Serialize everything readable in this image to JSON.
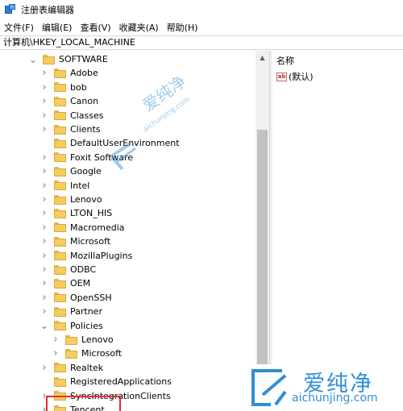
{
  "window": {
    "title": "注册表编辑器"
  },
  "menu": [
    {
      "label": "文件(F)"
    },
    {
      "label": "编辑(E)"
    },
    {
      "label": "查看(V)"
    },
    {
      "label": "收藏夹(A)"
    },
    {
      "label": "帮助(H)"
    }
  ],
  "address": {
    "path": "计算机\\HKEY_LOCAL_MACHINE"
  },
  "tree": {
    "items": [
      {
        "label": "SOFTWARE",
        "level": 0,
        "state": "expanded"
      },
      {
        "label": "Adobe",
        "level": 1,
        "state": "collapsed"
      },
      {
        "label": "bob",
        "level": 1,
        "state": "collapsed"
      },
      {
        "label": "Canon",
        "level": 1,
        "state": "collapsed"
      },
      {
        "label": "Classes",
        "level": 1,
        "state": "collapsed"
      },
      {
        "label": "Clients",
        "level": 1,
        "state": "collapsed"
      },
      {
        "label": "DefaultUserEnvironment",
        "level": 1,
        "state": "none"
      },
      {
        "label": "Foxit Software",
        "level": 1,
        "state": "collapsed"
      },
      {
        "label": "Google",
        "level": 1,
        "state": "collapsed"
      },
      {
        "label": "Intel",
        "level": 1,
        "state": "collapsed"
      },
      {
        "label": "Lenovo",
        "level": 1,
        "state": "collapsed"
      },
      {
        "label": "LTON_HIS",
        "level": 1,
        "state": "collapsed"
      },
      {
        "label": "Macromedia",
        "level": 1,
        "state": "collapsed"
      },
      {
        "label": "Microsoft",
        "level": 1,
        "state": "collapsed"
      },
      {
        "label": "MozillaPlugins",
        "level": 1,
        "state": "collapsed"
      },
      {
        "label": "ODBC",
        "level": 1,
        "state": "collapsed"
      },
      {
        "label": "OEM",
        "level": 1,
        "state": "collapsed"
      },
      {
        "label": "OpenSSH",
        "level": 1,
        "state": "collapsed"
      },
      {
        "label": "Partner",
        "level": 1,
        "state": "collapsed"
      },
      {
        "label": "Policies",
        "level": 1,
        "state": "expanded"
      },
      {
        "label": "Lenovo",
        "level": 2,
        "state": "collapsed"
      },
      {
        "label": "Microsoft",
        "level": 2,
        "state": "collapsed",
        "highlighted": true
      },
      {
        "label": "Realtek",
        "level": 1,
        "state": "collapsed"
      },
      {
        "label": "RegisteredApplications",
        "level": 1,
        "state": "none"
      },
      {
        "label": "SyncIntegrationClients",
        "level": 1,
        "state": "collapsed"
      },
      {
        "label": "Tencent",
        "level": 1,
        "state": "collapsed"
      }
    ]
  },
  "values_pane": {
    "column_name": "名称",
    "rows": [
      {
        "icon": "string-value-icon",
        "icon_text": "ab",
        "name": "(默认)"
      }
    ]
  },
  "watermark": {
    "brand": "爱纯净",
    "url_small": "aichunjing.com",
    "url": "aichunjing.com",
    "color": "#2f8fd6"
  },
  "colors": {
    "highlight_border": "#e0302b",
    "folder": "#f5cc5f",
    "scrollbar_thumb": "#c2c2c2"
  }
}
